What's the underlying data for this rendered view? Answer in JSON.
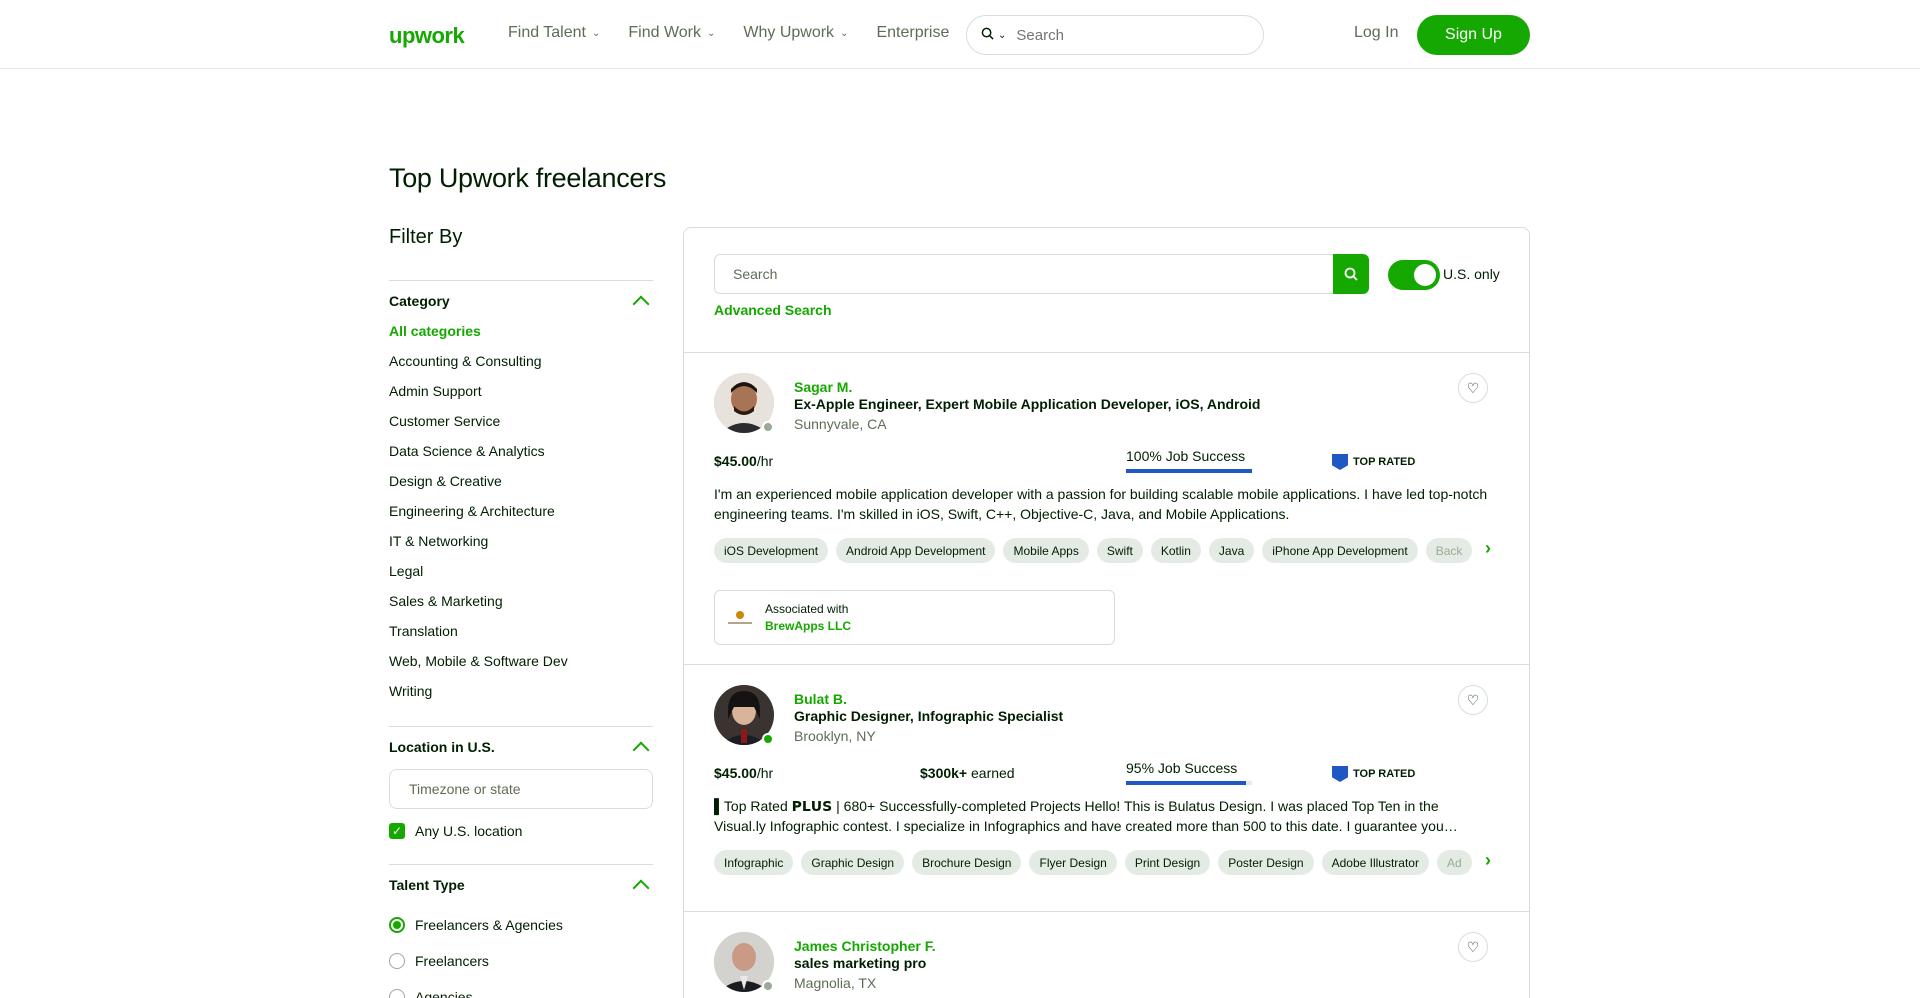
{
  "header": {
    "logo": "upwork",
    "nav": [
      {
        "label": "Find Talent",
        "has_dropdown": true
      },
      {
        "label": "Find Work",
        "has_dropdown": true
      },
      {
        "label": "Why Upwork",
        "has_dropdown": true
      },
      {
        "label": "Enterprise",
        "has_dropdown": false
      }
    ],
    "search_placeholder": "Search",
    "login": "Log In",
    "signup": "Sign Up"
  },
  "page_title": "Top Upwork freelancers",
  "sidebar": {
    "filter_by": "Filter By",
    "category": {
      "title": "Category",
      "items": [
        "All categories",
        "Accounting & Consulting",
        "Admin Support",
        "Customer Service",
        "Data Science & Analytics",
        "Design & Creative",
        "Engineering & Architecture",
        "IT & Networking",
        "Legal",
        "Sales & Marketing",
        "Translation",
        "Web, Mobile & Software Dev",
        "Writing"
      ],
      "active": "All categories"
    },
    "location": {
      "title": "Location in U.S.",
      "placeholder": "Timezone or state",
      "any_location": "Any U.S. location",
      "any_location_checked": true
    },
    "talent_type": {
      "title": "Talent Type",
      "options": [
        "Freelancers & Agencies",
        "Freelancers",
        "Agencies"
      ],
      "selected": "Freelancers & Agencies"
    }
  },
  "main": {
    "search_placeholder": "Search",
    "us_only_label": "U.S. only",
    "us_only_on": true,
    "advanced_search": "Advanced Search"
  },
  "freelancers": [
    {
      "name": "Sagar M.",
      "title": "Ex-Apple Engineer, Expert Mobile Application Developer, iOS, Android",
      "location": "Sunnyvale, CA",
      "online": false,
      "rate": "$45.00",
      "rate_unit": "/hr",
      "earned": "",
      "earned_label": "",
      "job_success": "100% Job Success",
      "job_success_pct": 100,
      "badge": "TOP RATED",
      "description": "I'm an experienced mobile application developer with a passion for building scalable mobile applications. I have led top-notch engineering teams. I'm skilled in iOS, Swift, C++, Objective-C, Java, and Mobile Applications.",
      "skills": [
        "iOS Development",
        "Android App Development",
        "Mobile Apps",
        "Swift",
        "Kotlin",
        "Java",
        "iPhone App Development",
        "Back"
      ],
      "associated_label": "Associated with",
      "associated_with": "BrewApps LLC"
    },
    {
      "name": "Bulat B.",
      "title": "Graphic Designer, Infographic Specialist",
      "location": "Brooklyn, NY",
      "online": true,
      "rate": "$45.00",
      "rate_unit": "/hr",
      "earned": "$300k+",
      "earned_label": " earned",
      "job_success": "95% Job Success",
      "job_success_pct": 95,
      "badge": "TOP RATED",
      "description": "▌Top Rated 𝗣𝗟𝗨𝗦 | 680+ Successfully-completed Projects Hello! This is Bulatus Design. I was placed Top Ten in the Visual.ly Infographic contest. I specialize in Infographics and have created more than 500 to this date. I guarantee you…",
      "skills": [
        "Infographic",
        "Graphic Design",
        "Brochure Design",
        "Flyer Design",
        "Print Design",
        "Poster Design",
        "Adobe Illustrator",
        "Ad"
      ]
    },
    {
      "name": "James Christopher F.",
      "title": "sales marketing pro",
      "location": "Magnolia, TX",
      "online": false
    }
  ],
  "colors": {
    "brand": "#14a800",
    "text": "#001e00",
    "muted": "#5e6d55",
    "border": "#d5e0d5",
    "badge": "#1f57c3"
  }
}
